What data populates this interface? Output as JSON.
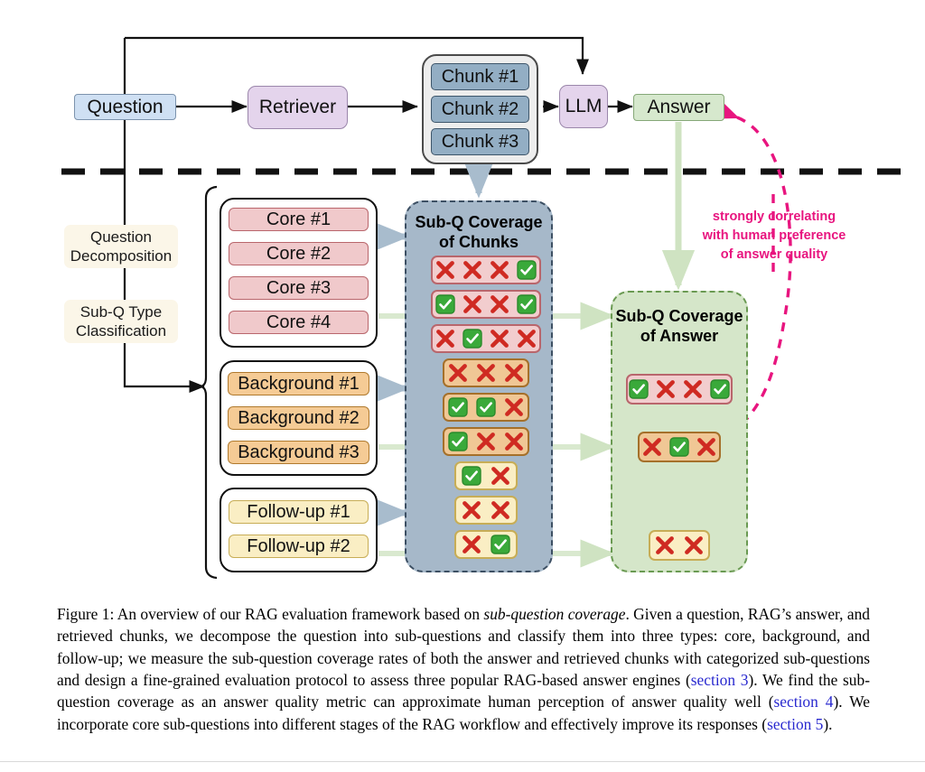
{
  "pipeline": {
    "question": "Question",
    "retriever": "Retriever",
    "llm": "LLM",
    "answer": "Answer",
    "chunks": [
      "Chunk #1",
      "Chunk #2",
      "Chunk #3"
    ]
  },
  "stages": {
    "decomposition": "Question\nDecomposition",
    "classification": "Sub-Q Type\nClassification"
  },
  "subquestions": {
    "core": [
      "Core #1",
      "Core #2",
      "Core #3",
      "Core #4"
    ],
    "background": [
      "Background #1",
      "Background #2",
      "Background #3"
    ],
    "followup": [
      "Follow-up #1",
      "Follow-up #2"
    ]
  },
  "panels": {
    "chunks": {
      "title": "Sub-Q Coverage\nof Chunks",
      "title_line1": "Sub-Q Coverage",
      "title_line2": "of Chunks",
      "rows": [
        {
          "type": "core",
          "marks": [
            "cross",
            "cross",
            "cross",
            "check"
          ]
        },
        {
          "type": "core",
          "marks": [
            "check",
            "cross",
            "cross",
            "check"
          ]
        },
        {
          "type": "core",
          "marks": [
            "cross",
            "check",
            "cross",
            "cross"
          ]
        },
        {
          "type": "background",
          "marks": [
            "cross",
            "cross",
            "cross"
          ]
        },
        {
          "type": "background",
          "marks": [
            "check",
            "check",
            "cross"
          ]
        },
        {
          "type": "background",
          "marks": [
            "check",
            "cross",
            "cross"
          ]
        },
        {
          "type": "followup",
          "marks": [
            "check",
            "cross"
          ]
        },
        {
          "type": "followup",
          "marks": [
            "cross",
            "cross"
          ]
        },
        {
          "type": "followup",
          "marks": [
            "cross",
            "check"
          ]
        }
      ]
    },
    "answer": {
      "title": "Sub-Q Coverage\nof Answer",
      "title_line1": "Sub-Q Coverage",
      "title_line2": "of Answer",
      "rows": [
        {
          "type": "core",
          "marks": [
            "check",
            "cross",
            "cross",
            "check"
          ]
        },
        {
          "type": "background",
          "marks": [
            "cross",
            "check",
            "cross"
          ]
        },
        {
          "type": "followup",
          "marks": [
            "cross",
            "cross"
          ]
        }
      ]
    }
  },
  "annotation": {
    "line1": "strongly correlating",
    "line2": "with human preference",
    "line3": "of answer quality"
  },
  "caption": {
    "label": "Figure 1:",
    "part1": " An overview of our RAG evaluation framework based on ",
    "italic1": "sub-question coverage",
    "part2": ". Given a question, RAG’s answer, and retrieved chunks, we decompose the question into sub-questions and classify them into three types: core, background, and follow-up; we measure the sub-question coverage rates of both the answer and retrieved chunks with categorized sub-questions and design a fine-grained evaluation protocol to assess three popular RAG-based answer engines (",
    "ref1": "section 3",
    "part3": "). We find the sub-question coverage as an answer quality metric can approximate human perception of answer quality well (",
    "ref2": "section 4",
    "part4": "). We incorporate core sub-questions into different stages of the RAG workflow and effectively improve its responses (",
    "ref3": "section 5",
    "part5": ")."
  },
  "colors": {
    "accent_pink": "#e8157f",
    "panel_chunks_bg": "#a6b8c9",
    "panel_answer_bg": "#d5e6c9",
    "core": "#f0c9cb",
    "background": "#f5cb95",
    "followup": "#faeec4",
    "check_green": "#3aa93a",
    "cross_red": "#cf2a22",
    "section_link": "#2929cf"
  }
}
